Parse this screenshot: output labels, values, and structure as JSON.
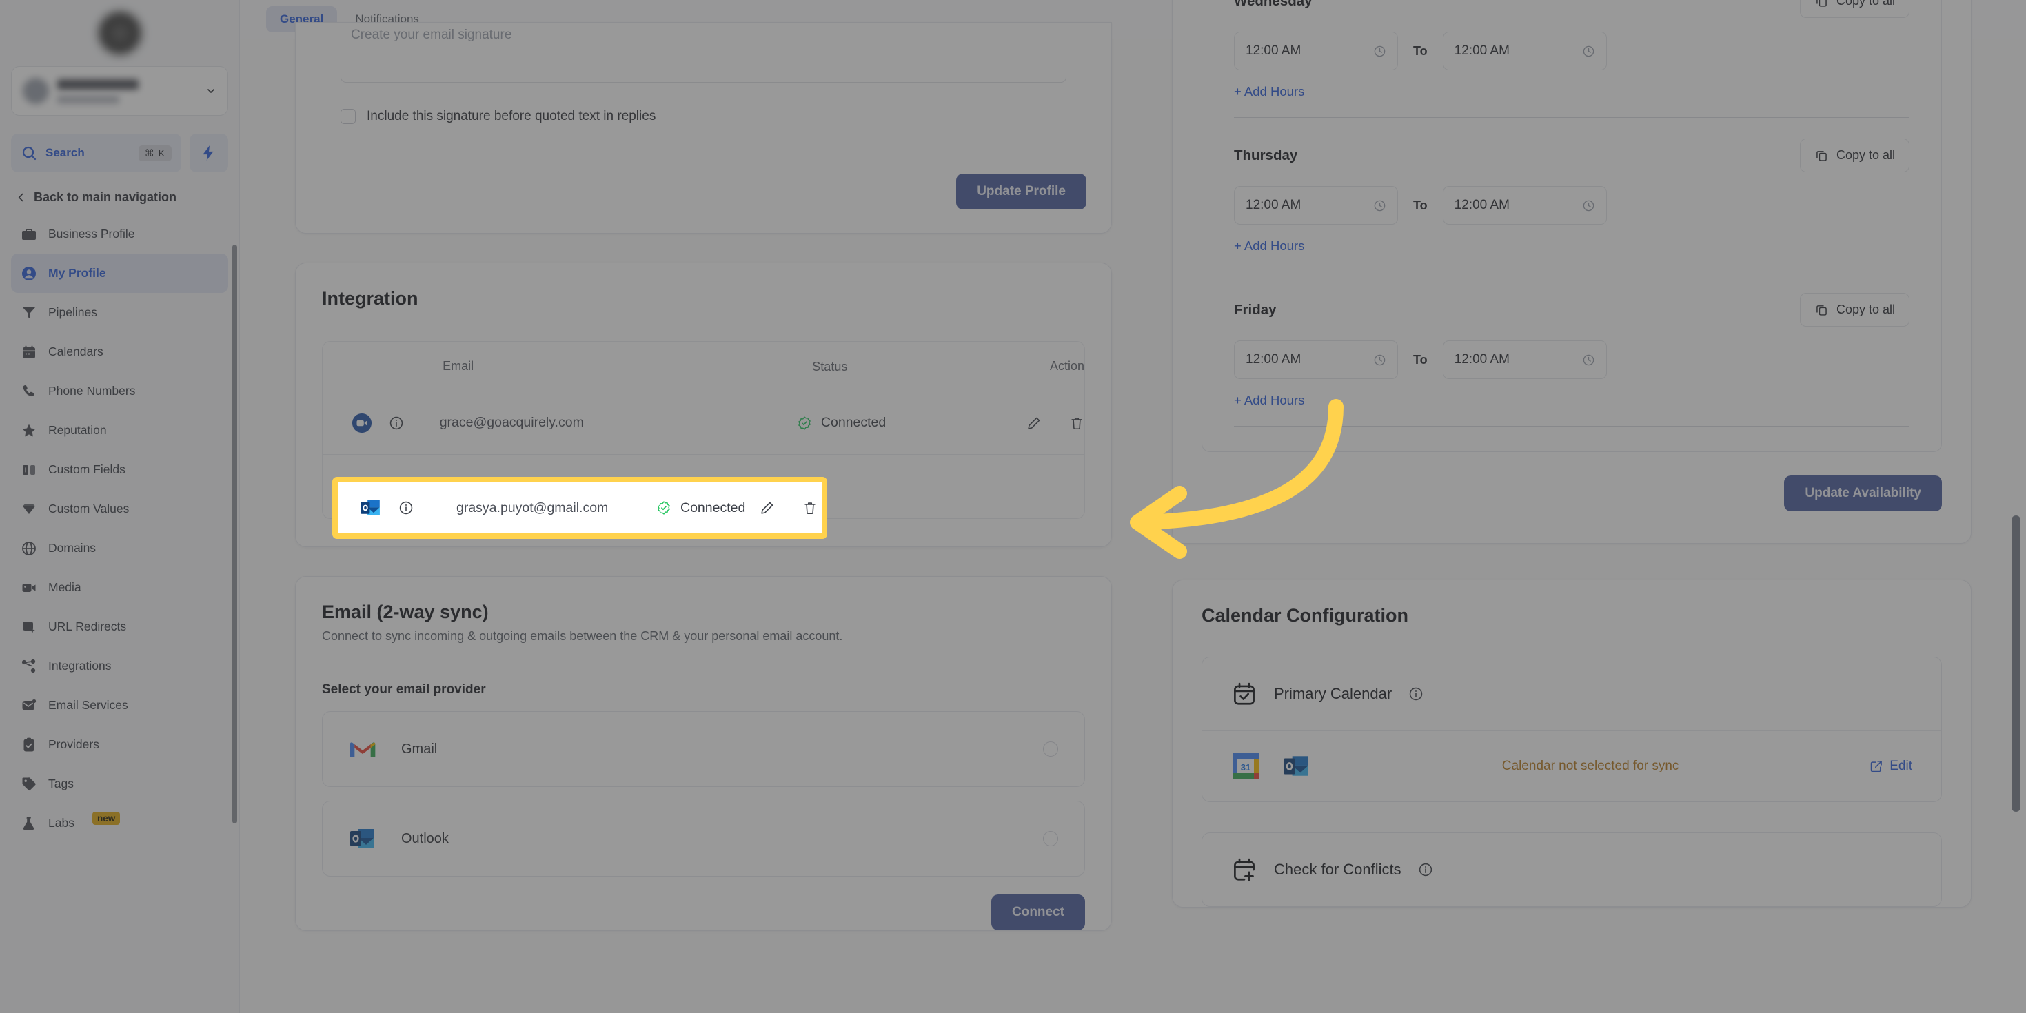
{
  "sidebar": {
    "workspace": {
      "name_redacted": true
    },
    "search": {
      "label": "Search",
      "shortcut": "⌘ K"
    },
    "back_nav": "Back to main navigation",
    "items": [
      {
        "label": "Business Profile",
        "icon": "briefcase-icon",
        "active": false
      },
      {
        "label": "My Profile",
        "icon": "user-circle-icon",
        "active": true
      },
      {
        "label": "Pipelines",
        "icon": "funnel-icon",
        "active": false
      },
      {
        "label": "Calendars",
        "icon": "calendar-icon",
        "active": false
      },
      {
        "label": "Phone Numbers",
        "icon": "phone-icon",
        "active": false
      },
      {
        "label": "Reputation",
        "icon": "star-icon",
        "active": false
      },
      {
        "label": "Custom Fields",
        "icon": "fields-icon",
        "active": false
      },
      {
        "label": "Custom Values",
        "icon": "diamond-icon",
        "active": false
      },
      {
        "label": "Domains",
        "icon": "globe-icon",
        "active": false
      },
      {
        "label": "Media",
        "icon": "video-camera-icon",
        "active": false
      },
      {
        "label": "URL Redirects",
        "icon": "redirect-icon",
        "active": false
      },
      {
        "label": "Integrations",
        "icon": "nodes-icon",
        "active": false
      },
      {
        "label": "Email Services",
        "icon": "mail-dot-icon",
        "active": false
      },
      {
        "label": "Providers",
        "icon": "clipboard-check-icon",
        "active": false
      },
      {
        "label": "Tags",
        "icon": "tag-icon",
        "active": false
      },
      {
        "label": "Labs",
        "icon": "flask-icon",
        "active": false,
        "badge": "new"
      }
    ]
  },
  "tabs": [
    {
      "label": "General",
      "active": true
    },
    {
      "label": "Notifications",
      "active": false
    }
  ],
  "signature": {
    "placeholder": "Create your email signature",
    "value": "",
    "checkbox_label": "Include this signature before quoted text in replies",
    "checked": false,
    "update_button": "Update Profile"
  },
  "integration": {
    "title": "Integration",
    "columns": [
      "",
      "Email",
      "Status",
      "Action"
    ],
    "rows": [
      {
        "provider_icon": "zoom-icon",
        "info_icon": "info-icon",
        "email": "grace@goacquirely.com",
        "status": "Connected",
        "status_icon": "check-badge-icon",
        "actions": [
          "edit-icon",
          "delete-icon"
        ],
        "highlighted": false
      },
      {
        "provider_icon": "outlook-icon",
        "info_icon": "info-icon",
        "email": "grasya.puyot@gmail.com",
        "status": "Connected",
        "status_icon": "check-badge-icon",
        "actions": [
          "edit-icon",
          "delete-icon"
        ],
        "highlighted": true
      }
    ]
  },
  "email_sync": {
    "title": "Email (2-way sync)",
    "subtitle": "Connect to sync incoming & outgoing emails between the CRM & your personal email account.",
    "select_label": "Select your email provider",
    "providers": [
      {
        "name": "Gmail",
        "icon": "gmail-icon",
        "selected": false
      },
      {
        "name": "Outlook",
        "icon": "outlook-icon",
        "selected": false
      }
    ],
    "connect_button": "Connect"
  },
  "availability": {
    "days": [
      {
        "name": "Wednesday",
        "copy_label": "Copy to all",
        "from": "12:00 AM",
        "to_word": "To",
        "to": "12:00 AM",
        "add_hours": "+ Add Hours"
      },
      {
        "name": "Thursday",
        "copy_label": "Copy to all",
        "from": "12:00 AM",
        "to_word": "To",
        "to": "12:00 AM",
        "add_hours": "+ Add Hours"
      },
      {
        "name": "Friday",
        "copy_label": "Copy to all",
        "from": "12:00 AM",
        "to_word": "To",
        "to": "12:00 AM",
        "add_hours": "+ Add Hours"
      }
    ],
    "update_button": "Update Availability"
  },
  "calendar_config": {
    "title": "Calendar Configuration",
    "primary": {
      "label": "Primary Calendar",
      "info_icon": "info-icon",
      "status": "Calendar not selected for sync",
      "edit_label": "Edit",
      "icons": [
        "google-calendar-icon",
        "outlook-icon"
      ]
    },
    "conflicts": {
      "label": "Check for Conflicts",
      "info_icon": "info-icon"
    }
  },
  "annotation": {
    "arrow": "curved-left-arrow",
    "highlight_color": "#ffd24d"
  },
  "colors": {
    "accent_blue": "#2b5cd9",
    "button_blue": "#4a5d9e",
    "connected_green": "#22c55e",
    "warning_amber": "#b7791f",
    "highlight_yellow": "#ffd24d",
    "badge_gold": "#e1a912"
  }
}
